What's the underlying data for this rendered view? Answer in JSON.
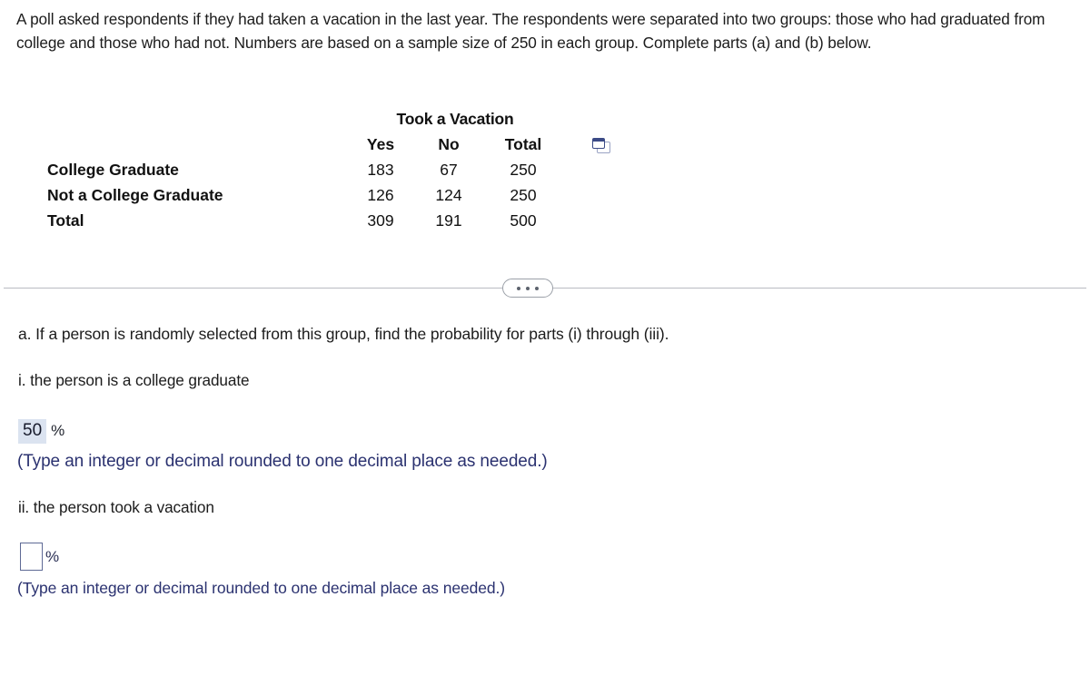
{
  "intro": {
    "text": "A poll asked respondents if they had taken a vacation in the last year. The respondents were separated into two groups: those who had graduated from college and those who had not. Numbers are based on a sample size of 250 in each group. Complete parts (a) and (b) below."
  },
  "table": {
    "group_header": "Took a Vacation",
    "columns": [
      "Yes",
      "No",
      "Total"
    ],
    "rows": [
      {
        "label": "College Graduate",
        "values": [
          "183",
          "67",
          "250"
        ]
      },
      {
        "label": "Not a College Graduate",
        "values": [
          "126",
          "124",
          "250"
        ]
      },
      {
        "label": "Total",
        "values": [
          "309",
          "191",
          "500"
        ]
      }
    ],
    "copy_icon": "copy-icon"
  },
  "divider": {
    "ellipsis_icon": "ellipsis-icon"
  },
  "question": {
    "part_a": "a. If a person is randomly selected from this group, find the probability for parts (i) through (iii).",
    "part_i": "i. the person is a college graduate",
    "part_ii": "ii. the person took a vacation"
  },
  "answers": {
    "first": {
      "value": "50",
      "unit": "%",
      "note": "(Type an integer or decimal rounded to one decimal place as needed.)"
    },
    "second": {
      "value": "",
      "placeholder": "",
      "unit": "%",
      "note": "(Type an integer or decimal rounded to one decimal place as needed.)"
    }
  },
  "colors": {
    "answer_highlight": "#dbe3f0",
    "note_text": "#2b3270",
    "input_border": "#5e6a95",
    "divider_line": "#b9bcc2"
  }
}
